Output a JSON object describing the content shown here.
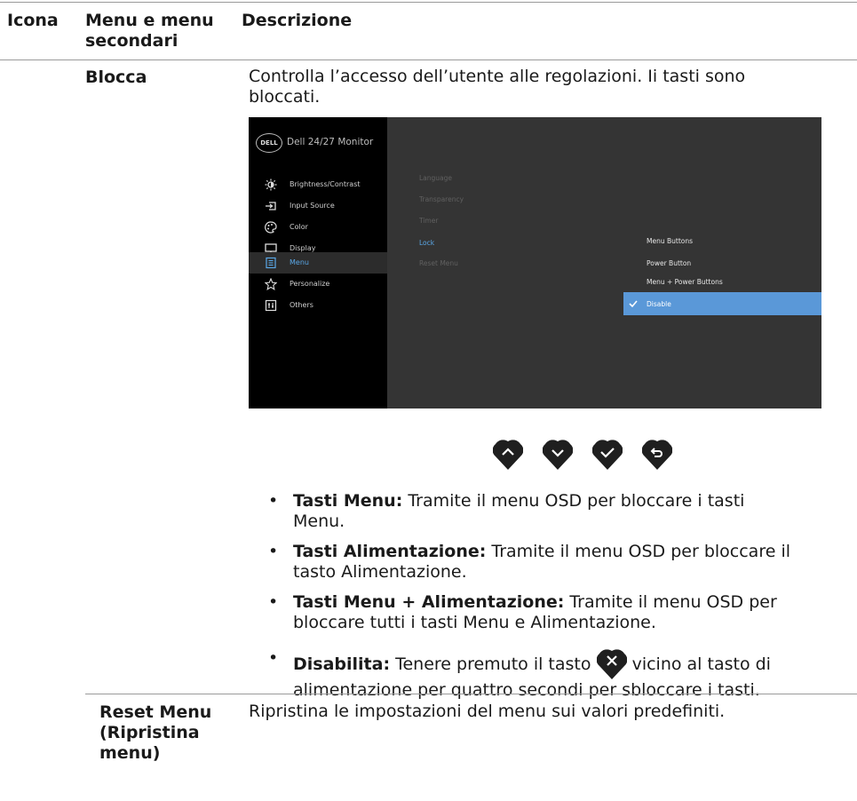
{
  "table_header": {
    "col_icon": "Icona",
    "col_menu_line1": "Menu e menu",
    "col_menu_line2": "secondari",
    "col_desc": "Descrizione"
  },
  "lock_row": {
    "label": "Blocca",
    "description_line1": "Controlla l’accesso dell’utente alle regolazioni. Ii tasti sono",
    "description_line2": "bloccati.",
    "osd": {
      "logo": "DELL",
      "title": "Dell 24/27 Monitor",
      "menu_items": [
        "Brightness/Contrast",
        "Input Source",
        "Color",
        "Display",
        "Menu",
        "Personalize",
        "Others"
      ],
      "active_menu": "Menu",
      "submenu_items": [
        "Language",
        "Transparency",
        "Timer",
        "Lock",
        "Reset Menu"
      ],
      "selected_submenu": "Lock",
      "options": [
        "Menu Buttons",
        "Power Button",
        "Menu + Power Buttons",
        "Disable"
      ],
      "selected_option": "Disable",
      "highlight_color": "#5a98d8"
    },
    "nav_buttons": [
      "up-icon",
      "down-icon",
      "check-icon",
      "back-icon"
    ],
    "bullets": [
      {
        "term": "Tasti Menu:",
        "line1": " Tramite il menu OSD per bloccare i tasti",
        "line2": "Menu."
      },
      {
        "term": "Tasti Alimentazione:",
        "line1": " Tramite il menu OSD per bloccare il",
        "line2": "tasto Alimentazione."
      },
      {
        "term": "Tasti Menu + Alimentazione:",
        "line1": " Tramite il menu OSD per",
        "line2": "bloccare tutti i tasti Menu e Alimentazione."
      },
      {
        "term": "Disabilita:",
        "line1a": " Tenere premuto il tasto ",
        "line1b": " vicino al tasto di",
        "line2": "alimentazione per quattro secondi per sbloccare i tasti."
      }
    ]
  },
  "reset_row": {
    "label_line1": "Reset Menu",
    "label_line2": "(Ripristina",
    "label_line3": "menu)",
    "description": "Ripristina le impostazioni del menu sui valori predefiniti."
  }
}
